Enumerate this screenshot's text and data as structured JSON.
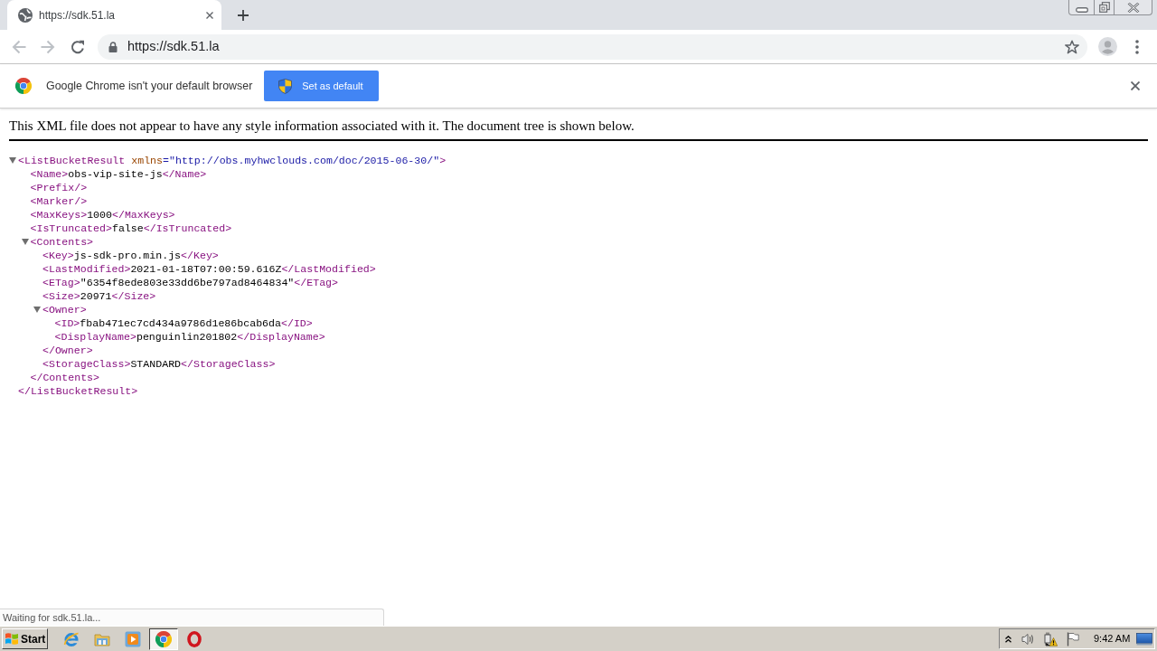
{
  "tabs": [
    {
      "title": "https://sdk.51.la",
      "selected": true
    }
  ],
  "toolbar": {
    "back": {
      "disabled": true
    },
    "forward": {
      "disabled": true
    },
    "url": "https://sdk.51.la"
  },
  "infobar": {
    "message": "Google Chrome isn't your default browser",
    "button": "Set as default"
  },
  "page": {
    "notice": "This XML file does not appear to have any style information associated with it. The document tree is shown below.",
    "xml_tree": {
      "open": "<ListBucketResult",
      "attributes": [
        {
          "name": "xmlns",
          "value": "=\"http://obs.myhwclouds.com/doc/2015-06-30/\""
        }
      ],
      "open_end": ">",
      "expanded": true,
      "children": [
        {
          "open": "<Name>",
          "text": "obs-vip-site-js",
          "close": "</Name>"
        },
        {
          "open": "<Prefix/>"
        },
        {
          "open": "<Marker/>"
        },
        {
          "open": "<MaxKeys>",
          "text": "1000",
          "close": "</MaxKeys>"
        },
        {
          "open": "<IsTruncated>",
          "text": "false",
          "close": "</IsTruncated>"
        },
        {
          "open": "<Contents>",
          "expanded": true,
          "children": [
            {
              "open": "<Key>",
              "text": "js-sdk-pro.min.js",
              "close": "</Key>"
            },
            {
              "open": "<LastModified>",
              "text": "2021-01-18T07:00:59.616Z",
              "close": "</LastModified>"
            },
            {
              "open": "<ETag>",
              "text": "\"6354f8ede803e33dd6be797ad8464834\"",
              "close": "</ETag>"
            },
            {
              "open": "<Size>",
              "text": "20971",
              "close": "</Size>"
            },
            {
              "open": "<Owner>",
              "expanded": true,
              "children": [
                {
                  "open": "<ID>",
                  "text": "fbab471ec7cd434a9786d1e86bcab6da",
                  "close": "</ID>"
                },
                {
                  "open": "<DisplayName>",
                  "text": "penguinlin201802",
                  "close": "</DisplayName>"
                }
              ],
              "close": "</Owner>"
            },
            {
              "open": "<StorageClass>",
              "text": "STANDARD",
              "close": "</StorageClass>"
            }
          ],
          "close": "</Contents>"
        }
      ],
      "close": "</ListBucketResult>"
    }
  },
  "status_bubble": {
    "text": "Waiting for sdk.51.la..."
  },
  "taskbar": {
    "start": "Start",
    "apps": [
      {
        "kind": "ie",
        "selected": false
      },
      {
        "kind": "explorer",
        "selected": false
      },
      {
        "kind": "media",
        "selected": false
      },
      {
        "kind": "chrome",
        "selected": true
      },
      {
        "kind": "opera",
        "selected": false
      }
    ],
    "clock": "9:42 AM"
  }
}
